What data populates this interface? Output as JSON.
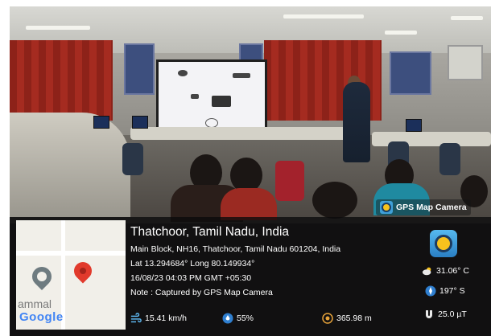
{
  "overlay": {
    "brand_label": "GPS Map Camera",
    "place_title": "Thatchoor, Tamil Nadu, India",
    "address": "Main Block, NH16, Thatchoor, Tamil Nadu 601204, India",
    "coordinates": "Lat 13.294684° Long 80.149934°",
    "datetime": "16/08/23 04:03 PM GMT +05:30",
    "note": "Note : Captured by GPS Map Camera"
  },
  "map": {
    "partial_label": "ammal",
    "logo_text": "Google"
  },
  "metrics": {
    "temperature": "31.06° C",
    "direction": "197° S",
    "magnetic": "25.0 µT",
    "wind_speed": "15.41 km/h",
    "humidity": "55%",
    "altitude": "365.98 m"
  },
  "colors": {
    "pin_red": "#e13a2c",
    "pin_grey": "#6e7b80",
    "panel_bg": "#0a0a0c",
    "app_icon_blue": "#3fa0d8",
    "curtain_red": "#a52b20"
  },
  "icons": [
    "camera-app-icon",
    "location-pin-icon",
    "cloud-temperature-icon",
    "compass-icon",
    "magnet-icon",
    "wind-icon",
    "humidity-icon",
    "altitude-icon"
  ]
}
